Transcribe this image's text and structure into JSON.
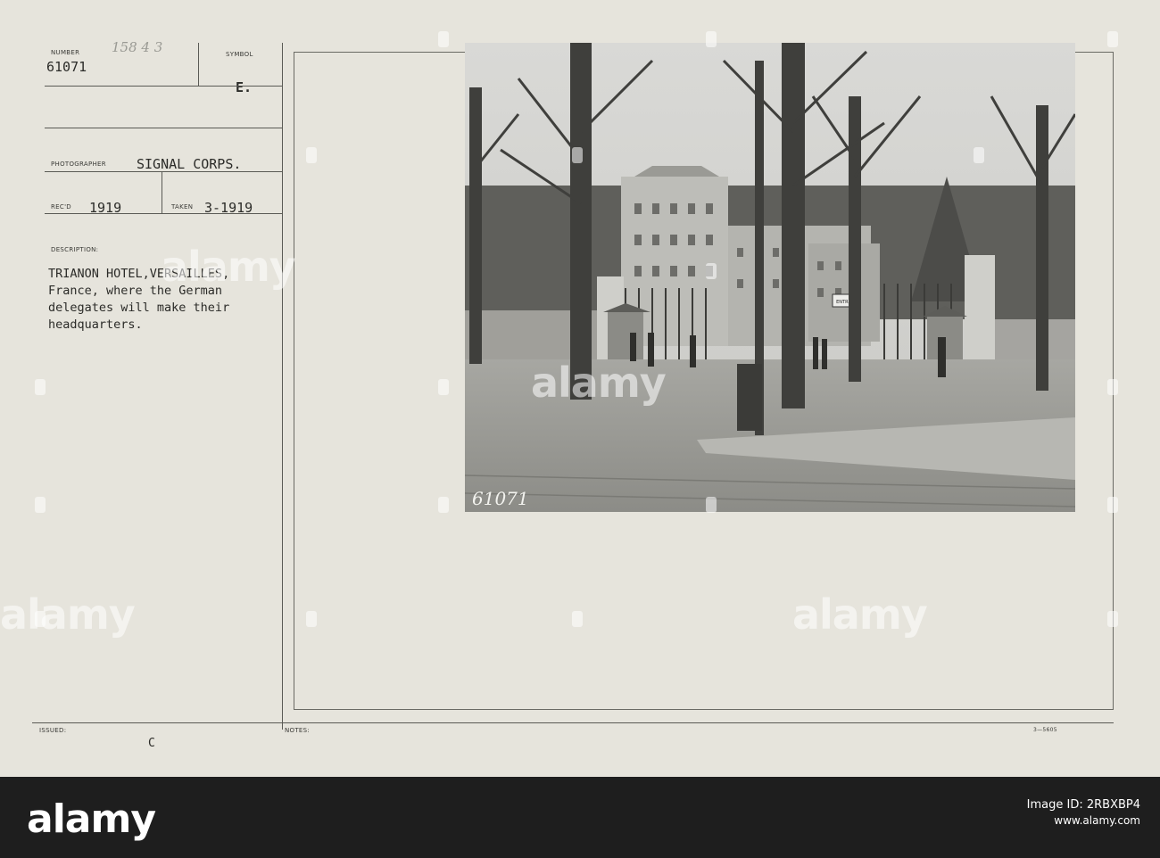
{
  "card": {
    "number_label": "NUMBER",
    "number_handwritten": "158 4 3",
    "number": "61071",
    "symbol_label": "SYMBOL",
    "symbol": "E.",
    "photographer_label": "PHOTOGRAPHER",
    "photographer": "SIGNAL CORPS.",
    "recd_label": "REC'D",
    "recd": "1919",
    "taken_label": "TAKEN",
    "taken": "3-1919",
    "description_label": "DESCRIPTION:",
    "description_lines": [
      "TRIANON HOTEL,VERSAILLES,",
      "France, where the German",
      "delegates will make their",
      "headquarters."
    ],
    "issued_label": "ISSUED:",
    "issued": "C",
    "notes_label": "NOTES:",
    "form_code": "3—5605",
    "photo_inscription": "61071",
    "photo_sign_text": "ENTREE"
  },
  "watermark": {
    "text": "alamy"
  },
  "footer": {
    "logo": "alamy",
    "image_id": "Image ID: 2RBXBP4",
    "site": "www.alamy.com"
  },
  "colors": {
    "card": "#e6e4dc",
    "footer": "#1e1e1e"
  }
}
